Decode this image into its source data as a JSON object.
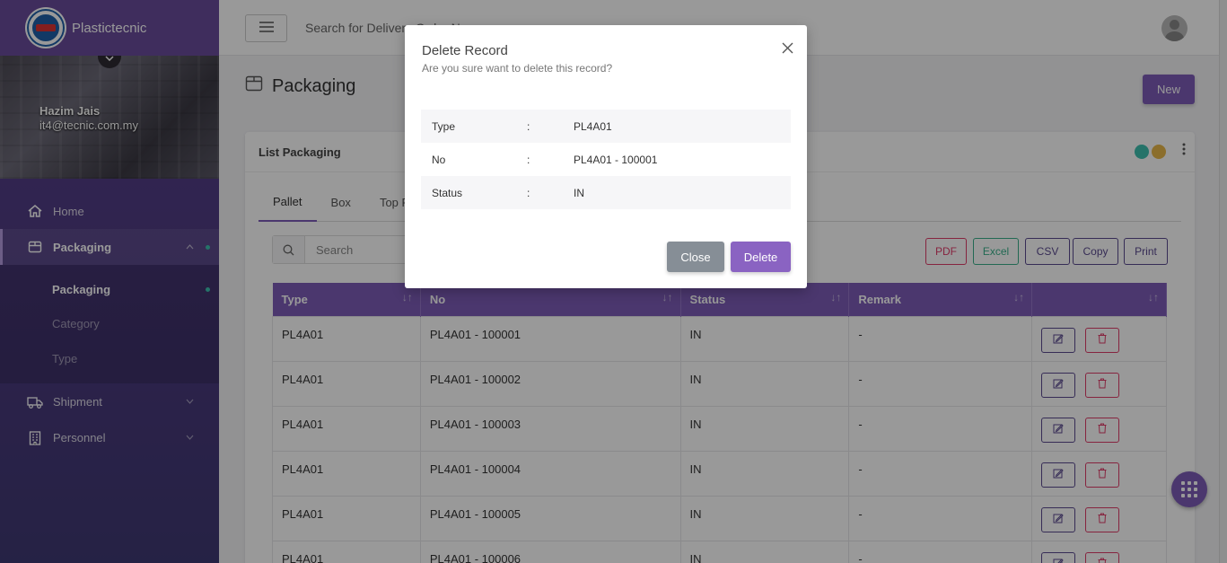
{
  "app": {
    "brand": "Plastictecnic"
  },
  "profile": {
    "name": "Hazim Jais",
    "email": "it4@tecnic.com.my"
  },
  "sidebar": {
    "items": [
      {
        "label": "Home",
        "icon": "home-icon"
      },
      {
        "label": "Packaging",
        "icon": "box-icon"
      },
      {
        "label": "Shipment",
        "icon": "truck-icon"
      },
      {
        "label": "Personnel",
        "icon": "building-icon"
      }
    ],
    "sub_items": [
      {
        "label": "Packaging"
      },
      {
        "label": "Category"
      },
      {
        "label": "Type"
      }
    ]
  },
  "topbar": {
    "search_placeholder": "Search for Delivery Order N..."
  },
  "page": {
    "title": "Packaging",
    "new_label": "New"
  },
  "card": {
    "title": "List Packaging",
    "status_colors": [
      "#3fc0b0",
      "#e8b84a"
    ],
    "tabs": [
      "Pallet",
      "Box",
      "Top Fr"
    ],
    "search_placeholder": "Search",
    "exports": [
      {
        "label": "PDF",
        "color": "#e03c6a"
      },
      {
        "label": "Excel",
        "color": "#3ab08a"
      },
      {
        "label": "CSV",
        "color": "#5a4a8f"
      },
      {
        "label": "Copy",
        "color": "#5a4a8f"
      },
      {
        "label": "Print",
        "color": "#5a4a8f"
      }
    ]
  },
  "table": {
    "headers": [
      "Type",
      "No",
      "Status",
      "Remark",
      ""
    ],
    "rows": [
      {
        "type": "PL4A01",
        "no": "PL4A01 - 100001",
        "status": "IN",
        "remark": "-"
      },
      {
        "type": "PL4A01",
        "no": "PL4A01 - 100002",
        "status": "IN",
        "remark": "-"
      },
      {
        "type": "PL4A01",
        "no": "PL4A01 - 100003",
        "status": "IN",
        "remark": "-"
      },
      {
        "type": "PL4A01",
        "no": "PL4A01 - 100004",
        "status": "IN",
        "remark": "-"
      },
      {
        "type": "PL4A01",
        "no": "PL4A01 - 100005",
        "status": "IN",
        "remark": "-"
      },
      {
        "type": "PL4A01",
        "no": "PL4A01 - 100006",
        "status": "IN",
        "remark": "-"
      }
    ]
  },
  "modal": {
    "title": "Delete Record",
    "subtitle": "Are you sure want to delete this record?",
    "fields": [
      {
        "key": "Type",
        "sep": ":",
        "value": "PL4A01"
      },
      {
        "key": "No",
        "sep": ":",
        "value": "PL4A01 - 100001"
      },
      {
        "key": "Status",
        "sep": ":",
        "value": "IN"
      }
    ],
    "close_label": "Close",
    "delete_label": "Delete"
  },
  "colors": {
    "accent": "#7d5cb8",
    "close_button": "#868e96",
    "delete_button": "#8a63c2"
  }
}
